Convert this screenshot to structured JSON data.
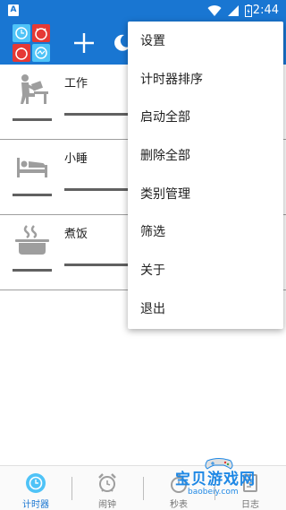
{
  "status_bar": {
    "badge": "A",
    "time": "2:44",
    "icons": [
      "wifi-icon",
      "signal-icon",
      "battery-icon"
    ]
  },
  "toolbar": {
    "icons": [
      "app-logo-icon",
      "add-icon",
      "moon-icon"
    ],
    "color": "#1976d2"
  },
  "timers": [
    {
      "title": "工作",
      "icon": "desk-work-icon"
    },
    {
      "title": "小睡",
      "icon": "bed-icon"
    },
    {
      "title": "煮饭",
      "icon": "cooking-pot-icon"
    }
  ],
  "menu": {
    "items": [
      "设置",
      "计时器排序",
      "启动全部",
      "删除全部",
      "类别管理",
      "筛选",
      "关于",
      "退出"
    ]
  },
  "bottom_nav": {
    "items": [
      {
        "label": "计时器",
        "icon": "timer-icon",
        "active": true
      },
      {
        "label": "闹钟",
        "icon": "alarm-clock-icon",
        "active": false
      },
      {
        "label": "秒表",
        "icon": "stopwatch-icon",
        "active": false
      },
      {
        "label": "日志",
        "icon": "log-icon",
        "active": false
      }
    ],
    "active_color": "#1976d2"
  },
  "watermark": {
    "text": "宝贝游戏网",
    "url": "baobeiy.com"
  }
}
